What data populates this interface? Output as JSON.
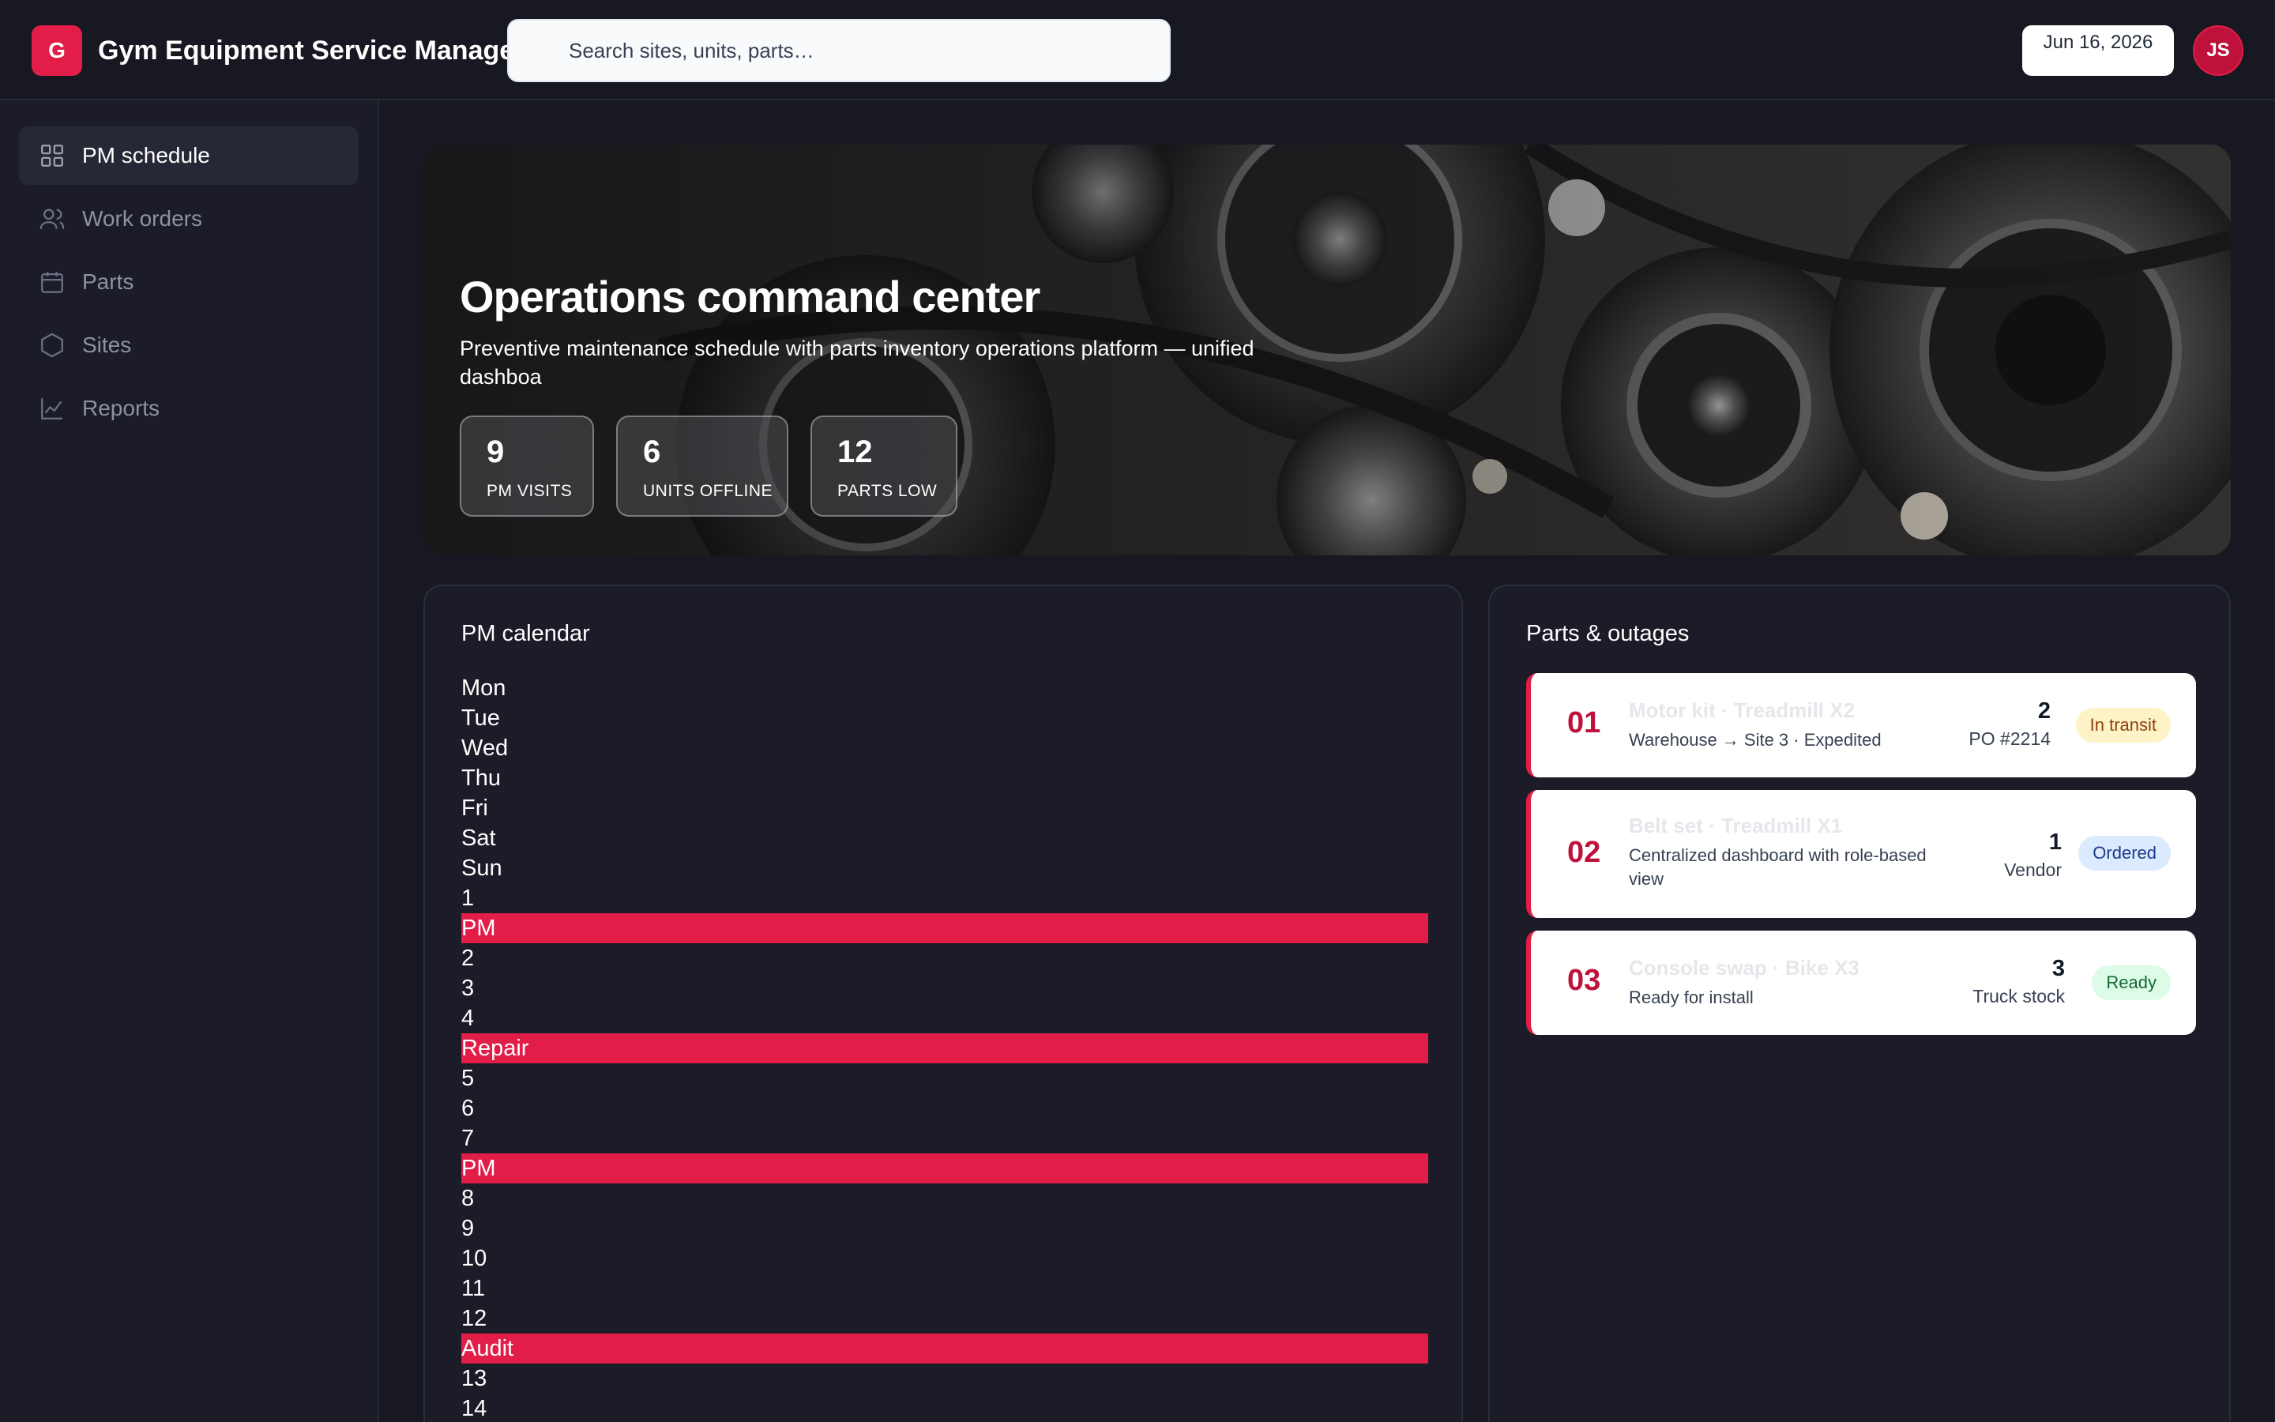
{
  "app": {
    "logo_letter": "G",
    "title": "Gym Equipment Service Manager"
  },
  "search": {
    "placeholder": "Search sites, units, parts…"
  },
  "header": {
    "date": "Jun 16, 2026",
    "avatar_initials": "JS"
  },
  "sidebar": {
    "items": [
      {
        "label": "PM schedule",
        "icon": "grid-icon",
        "active": true
      },
      {
        "label": "Work orders",
        "icon": "users-icon",
        "active": false
      },
      {
        "label": "Parts",
        "icon": "calendar-icon",
        "active": false
      },
      {
        "label": "Sites",
        "icon": "hexagon-icon",
        "active": false
      },
      {
        "label": "Reports",
        "icon": "chart-icon",
        "active": false
      }
    ]
  },
  "hero": {
    "title": "Operations command center",
    "subtitle": "Preventive maintenance schedule with parts inventory operations platform — unified dashboa",
    "stats": [
      {
        "value": "9",
        "label": "PM VISITS"
      },
      {
        "value": "6",
        "label": "UNITS OFFLINE"
      },
      {
        "value": "12",
        "label": "PARTS LOW"
      }
    ]
  },
  "calendar": {
    "title": "PM calendar",
    "lines": [
      {
        "text": "Mon",
        "event": false
      },
      {
        "text": "Tue",
        "event": false
      },
      {
        "text": "Wed",
        "event": false
      },
      {
        "text": "Thu",
        "event": false
      },
      {
        "text": "Fri",
        "event": false
      },
      {
        "text": "Sat",
        "event": false
      },
      {
        "text": "Sun",
        "event": false
      },
      {
        "text": "1",
        "event": false
      },
      {
        "text": "PM",
        "event": true
      },
      {
        "text": "2",
        "event": false
      },
      {
        "text": "3",
        "event": false
      },
      {
        "text": "4",
        "event": false
      },
      {
        "text": "Repair",
        "event": true
      },
      {
        "text": "5",
        "event": false
      },
      {
        "text": "6",
        "event": false
      },
      {
        "text": "7",
        "event": false
      },
      {
        "text": "PM",
        "event": true
      },
      {
        "text": "8",
        "event": false
      },
      {
        "text": "9",
        "event": false
      },
      {
        "text": "10",
        "event": false
      },
      {
        "text": "11",
        "event": false
      },
      {
        "text": "12",
        "event": false
      },
      {
        "text": "Audit",
        "event": true
      },
      {
        "text": "13",
        "event": false
      },
      {
        "text": "14",
        "event": false
      }
    ]
  },
  "parts": {
    "title": "Parts & outages",
    "items": [
      {
        "index": "01",
        "name": "Motor kit · Treadmill X2",
        "desc": "Warehouse → Site 3 · Expedited",
        "qty": "2",
        "qty_sub": "PO #2214",
        "status": "In transit",
        "status_bg": "#fef3c7",
        "status_fg": "#92400e"
      },
      {
        "index": "02",
        "name": "Belt set · Treadmill X1",
        "desc": "Centralized dashboard with role-based view",
        "qty": "1",
        "qty_sub": "Vendor",
        "status": "Ordered",
        "status_bg": "#dbeafe",
        "status_fg": "#1e3a8a"
      },
      {
        "index": "03",
        "name": "Console swap · Bike X3",
        "desc": "Ready for install",
        "qty": "3",
        "qty_sub": "Truck stock",
        "status": "Ready",
        "status_bg": "#dcfce7",
        "status_fg": "#166534"
      }
    ]
  },
  "colors": {
    "accent": "#e11d48",
    "background": "#171821",
    "panel": "#1b1c27"
  }
}
